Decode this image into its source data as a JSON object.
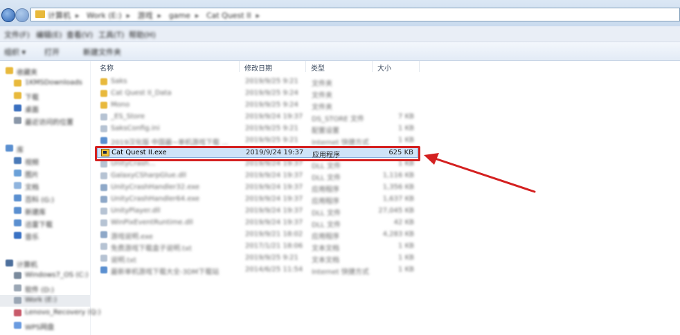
{
  "address": {
    "crumbs": [
      "计算机",
      "Work (E:)",
      "游戏",
      "game",
      "Cat Quest II"
    ]
  },
  "menu": [
    "文件(F)",
    "编辑(E)",
    "查看(V)",
    "工具(T)",
    "帮助(H)"
  ],
  "toolbar": [
    "组织 ▾",
    "打开",
    "新建文件夹"
  ],
  "nav": {
    "favorites": {
      "label": "收藏夹",
      "items": [
        "1KMSDownloads",
        "下载",
        "桌面",
        "最近访问的位置"
      ]
    },
    "libraries": {
      "label": "库",
      "items": [
        "视频",
        "图片",
        "文档",
        "百科 (G:)",
        "新建库",
        "迅雷下载",
        "音乐"
      ]
    },
    "computer": {
      "label": "计算机",
      "items": [
        "Windows7_OS (C:)",
        "软件 (D:)",
        "Work (E:)",
        "Lenovo_Recovery (Q:)"
      ],
      "network": "WPS网盘"
    }
  },
  "columns": {
    "name": "名称",
    "date": "修改日期",
    "type": "类型",
    "size": "大小"
  },
  "files": [
    {
      "name": "Saks",
      "date": "2019/9/25 9:21",
      "type": "文件夹",
      "size": "",
      "icon": "folder"
    },
    {
      "name": "Cat Quest II_Data",
      "date": "2019/9/25 9:24",
      "type": "文件夹",
      "size": "",
      "icon": "folder"
    },
    {
      "name": "Mono",
      "date": "2019/9/25 9:24",
      "type": "文件夹",
      "size": "",
      "icon": "folder"
    },
    {
      "name": "_ES_Store",
      "date": "2019/9/24 19:37",
      "type": "DS_STORE 文件",
      "size": "7 KB",
      "icon": "file"
    },
    {
      "name": "SaksConfig.ini",
      "date": "2019/9/25 9:21",
      "type": "配置设置",
      "size": "1 KB",
      "icon": "file"
    },
    {
      "name": "2019汉化版 中国最~单机游戏下载 ...",
      "date": "2019/9/25 9:21",
      "type": "Internet 快捷方式",
      "size": "1 KB",
      "icon": "link"
    },
    {
      "name": "Cat Quest II.exe",
      "date": "2019/9/24 19:37",
      "type": "应用程序",
      "size": "625 KB",
      "icon": "exe",
      "selected": true
    },
    {
      "name": "UnityCrash...",
      "date": "2019/9/24 19:37",
      "type": "DLL 文件",
      "size": "1 KB",
      "icon": "file"
    },
    {
      "name": "GalaxyCSharpGlue.dll",
      "date": "2019/9/24 19:37",
      "type": "DLL 文件",
      "size": "1,116 KB",
      "icon": "file"
    },
    {
      "name": "UnityCrashHandler32.exe",
      "date": "2019/9/24 19:37",
      "type": "应用程序",
      "size": "1,356 KB",
      "icon": "exe"
    },
    {
      "name": "UnityCrashHandler64.exe",
      "date": "2019/9/24 19:37",
      "type": "应用程序",
      "size": "1,637 KB",
      "icon": "exe"
    },
    {
      "name": "UnityPlayer.dll",
      "date": "2019/9/24 19:37",
      "type": "DLL 文件",
      "size": "27,045 KB",
      "icon": "file"
    },
    {
      "name": "WinPixEventRuntime.dll",
      "date": "2019/9/24 19:37",
      "type": "DLL 文件",
      "size": "42 KB",
      "icon": "file"
    },
    {
      "name": "游戏说明.exe",
      "date": "2019/9/21 18:02",
      "type": "应用程序",
      "size": "4,283 KB",
      "icon": "exe"
    },
    {
      "name": "免费游戏下载盒子说明.txt",
      "date": "2017/1/21 18:06",
      "type": "文本文档",
      "size": "1 KB",
      "icon": "file"
    },
    {
      "name": "说明.txt",
      "date": "2019/9/25 9:21",
      "type": "文本文档",
      "size": "1 KB",
      "icon": "file"
    },
    {
      "name": "最新单机游戏下载大全-3DM下载站",
      "date": "2014/6/25 11:54",
      "type": "Internet 快捷方式",
      "size": "1 KB",
      "icon": "link"
    }
  ],
  "colors": {
    "selection": "#cfe3f8",
    "highlight": "#d42020",
    "folder": "#e8b93c"
  }
}
